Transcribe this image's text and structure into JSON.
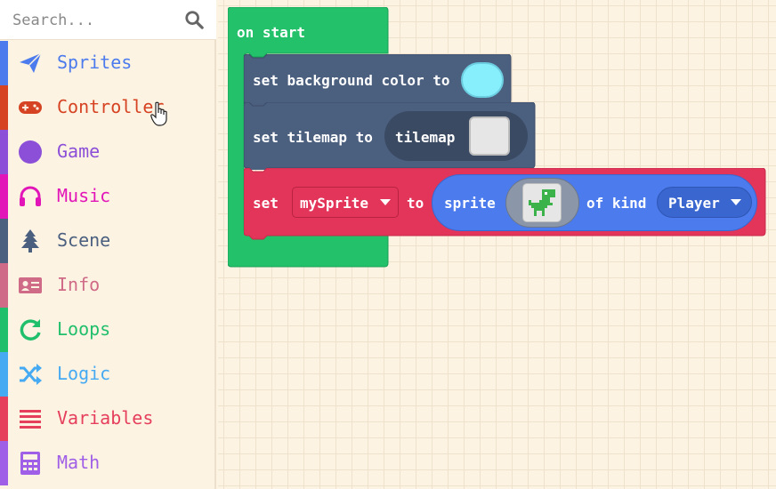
{
  "search": {
    "placeholder": "Search..."
  },
  "categories": [
    {
      "label": "Sprites",
      "color": "#4b7bec",
      "icon": "paper-plane-icon"
    },
    {
      "label": "Controller",
      "color": "#d54322",
      "icon": "gamepad-icon"
    },
    {
      "label": "Game",
      "color": "#8b4fd8",
      "icon": "circle-icon"
    },
    {
      "label": "Music",
      "color": "#e216b8",
      "icon": "headphones-icon"
    },
    {
      "label": "Scene",
      "color": "#4b5f7f",
      "icon": "tree-icon"
    },
    {
      "label": "Info",
      "color": "#cf6a87",
      "icon": "id-card-icon"
    },
    {
      "label": "Loops",
      "color": "#20bf6b",
      "icon": "refresh-icon"
    },
    {
      "label": "Logic",
      "color": "#45aaf2",
      "icon": "shuffle-icon"
    },
    {
      "label": "Variables",
      "color": "#e53f5c",
      "icon": "list-icon"
    },
    {
      "label": "Math",
      "color": "#9f5fe6",
      "icon": "calculator-icon"
    }
  ],
  "blocks": {
    "on_start": {
      "label": "on start",
      "color": "#23c16a"
    },
    "set_bg": {
      "prefix": "set background color to",
      "color": "#4b5f7f",
      "swatch": "#87eefc"
    },
    "set_tilemap": {
      "prefix": "set tilemap to",
      "inner": "tilemap",
      "color": "#4b5f7f"
    },
    "set_sprite": {
      "set": "set",
      "variable": "mySprite",
      "to": "to",
      "sprite": "sprite",
      "of_kind": "of kind",
      "kind": "Player",
      "color": "#e3355a",
      "sprite_color": "#4b7bec"
    }
  }
}
